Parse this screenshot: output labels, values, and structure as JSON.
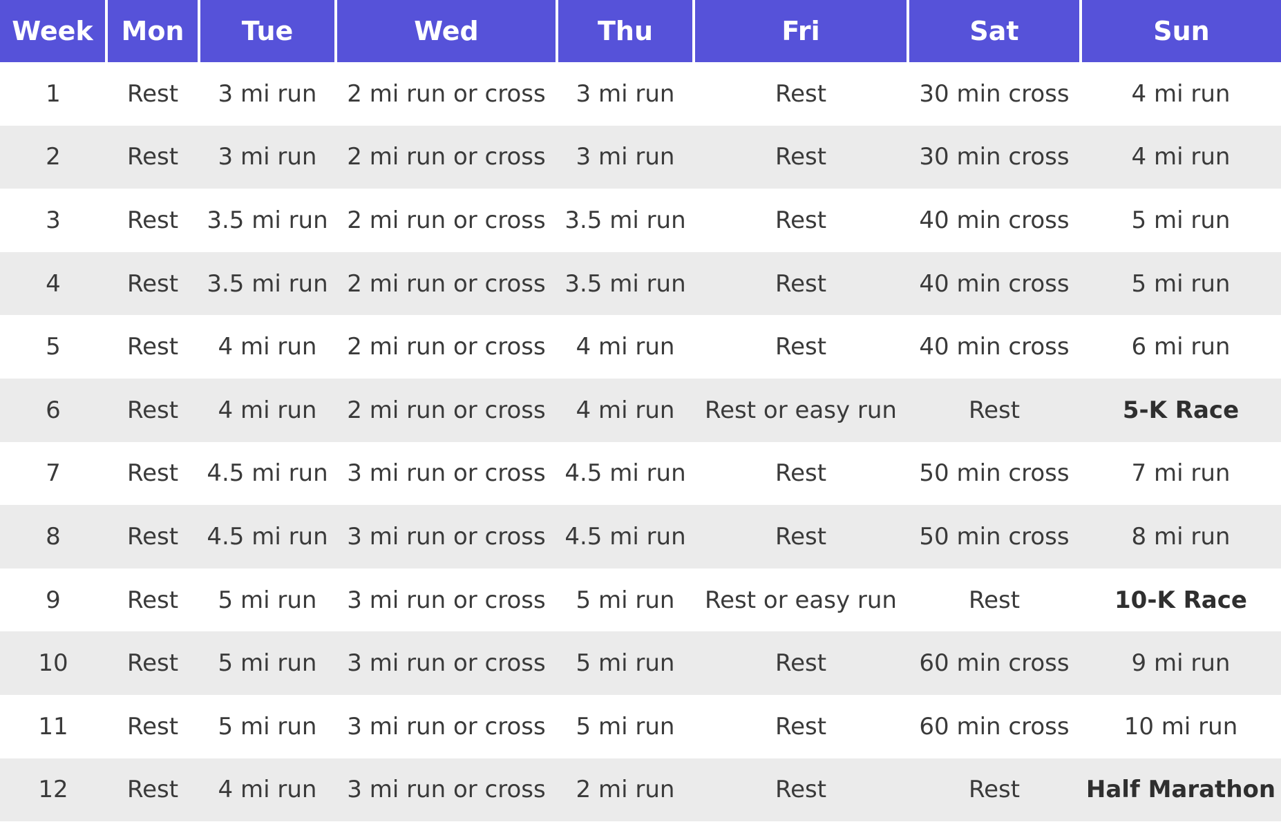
{
  "header": {
    "columns": [
      "Week",
      "Mon",
      "Tue",
      "Wed",
      "Thu",
      "Fri",
      "Sat",
      "Sun"
    ]
  },
  "rows": [
    [
      "1",
      "Rest",
      "3 mi run",
      "2 mi run or cross",
      "3 mi run",
      "Rest",
      "30 min cross",
      "4 mi run"
    ],
    [
      "2",
      "Rest",
      "3 mi run",
      "2 mi run or cross",
      "3 mi run",
      "Rest",
      "30 min cross",
      "4 mi run"
    ],
    [
      "3",
      "Rest",
      "3.5 mi run",
      "2 mi run or cross",
      "3.5 mi run",
      "Rest",
      "40 min cross",
      "5 mi run"
    ],
    [
      "4",
      "Rest",
      "3.5 mi run",
      "2 mi run or cross",
      "3.5 mi run",
      "Rest",
      "40 min cross",
      "5 mi run"
    ],
    [
      "5",
      "Rest",
      "4 mi run",
      "2 mi run or cross",
      "4 mi run",
      "Rest",
      "40 min cross",
      "6 mi run"
    ],
    [
      "6",
      "Rest",
      "4 mi run",
      "2 mi run or cross",
      "4 mi run",
      "Rest or easy run",
      "Rest",
      "5-K Race"
    ],
    [
      "7",
      "Rest",
      "4.5 mi run",
      "3 mi run or cross",
      "4.5 mi run",
      "Rest",
      "50 min cross",
      "7 mi run"
    ],
    [
      "8",
      "Rest",
      "4.5 mi run",
      "3 mi run or cross",
      "4.5 mi run",
      "Rest",
      "50 min cross",
      "8 mi run"
    ],
    [
      "9",
      "Rest",
      "5 mi run",
      "3 mi run or cross",
      "5 mi run",
      "Rest or easy run",
      "Rest",
      "10-K Race"
    ],
    [
      "10",
      "Rest",
      "5 mi run",
      "3 mi run or cross",
      "5 mi run",
      "Rest",
      "60 min cross",
      "9 mi run"
    ],
    [
      "11",
      "Rest",
      "5 mi run",
      "3 mi run or cross",
      "5 mi run",
      "Rest",
      "60 min cross",
      "10 mi run"
    ],
    [
      "12",
      "Rest",
      "4 mi run",
      "3 mi run or cross",
      "2 mi run",
      "Rest",
      "Rest",
      "Half Marathon"
    ]
  ],
  "emphasis": [
    "5-K Race",
    "10-K Race",
    "Half Marathon"
  ],
  "colors": {
    "header_background": "#5652d9",
    "header_text": "#ffffff",
    "stripe_background": "#ebebeb",
    "body_text": "#3a3a3a"
  }
}
